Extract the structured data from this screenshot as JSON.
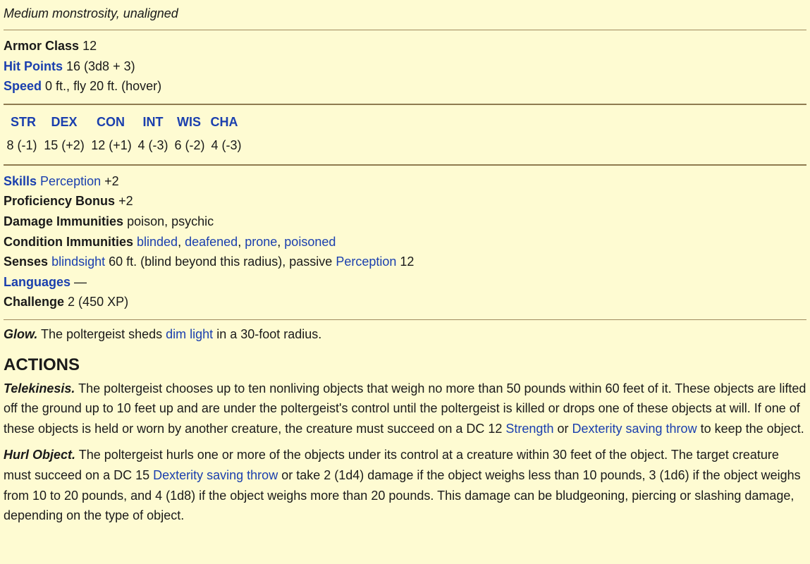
{
  "subtitle": "Medium monstrosity, unaligned",
  "basics": {
    "ac_label": "Armor Class",
    "ac_value": "12",
    "hp_label": "Hit Points",
    "hp_value": "16 (3d8 + 3)",
    "speed_label": "Speed",
    "speed_value": "0 ft., fly 20 ft. (hover)"
  },
  "abilities": {
    "headers": [
      "STR",
      "DEX",
      "CON",
      "INT",
      "WIS",
      "CHA"
    ],
    "values": [
      "8 (-1)",
      "15 (+2)",
      "12 (+1)",
      "4 (-3)",
      "6 (-2)",
      "4 (-3)"
    ]
  },
  "details": {
    "skills_label": "Skills",
    "skills_link": "Perception",
    "skills_value": "+2",
    "prof_label": "Proficiency Bonus",
    "prof_value": "+2",
    "dmg_imm_label": "Damage Immunities",
    "dmg_imm_value": "poison, psychic",
    "cond_imm_label": "Condition Immunities",
    "cond_imm_links": [
      "blinded",
      "deafened",
      "prone",
      "poisoned"
    ],
    "senses_label": "Senses",
    "senses_link1": "blindsight",
    "senses_text1": "60 ft. (blind beyond this radius), passive",
    "senses_link2": "Perception",
    "senses_text2": "12",
    "lang_label": "Languages",
    "lang_value": "—",
    "challenge_label": "Challenge",
    "challenge_value": "2 (450 XP)"
  },
  "trait": {
    "name": "Glow.",
    "text1": "The poltergeist sheds",
    "link": "dim light",
    "text2": "in a 30-foot radius."
  },
  "actions": {
    "heading": "ACTIONS",
    "telekinesis": {
      "name": "Telekinesis.",
      "text1": "The poltergeist chooses up to ten nonliving objects that weigh no more than 50 pounds within 60 feet of it. These objects are lifted off the ground up to 10 feet up and are under the poltergeist's control until the poltergeist is killed or drops one of these objects at will. If one of these objects is held or worn by another creature, the creature must succeed on a DC 12",
      "link1": "Strength",
      "or": "or",
      "link2": "Dexterity saving throw",
      "text2": "to keep the object."
    },
    "hurl": {
      "name": "Hurl Object.",
      "text1": "The poltergeist hurls one or more of the objects under its control at a creature within 30 feet of the object. The target creature must succeed on a DC 15",
      "link": "Dexterity saving throw",
      "text2": "or take 2 (1d4) damage if the object weighs less than 10 pounds, 3 (1d6) if the object weighs from 10 to 20 pounds, and 4 (1d8) if the object weighs more than 20 pounds. This damage can be bludgeoning, piercing or slashing damage, depending on the type of object."
    }
  },
  "colors": {
    "background": "#fefbd2",
    "link": "#1a3fae",
    "rule": "#a08a5e"
  }
}
